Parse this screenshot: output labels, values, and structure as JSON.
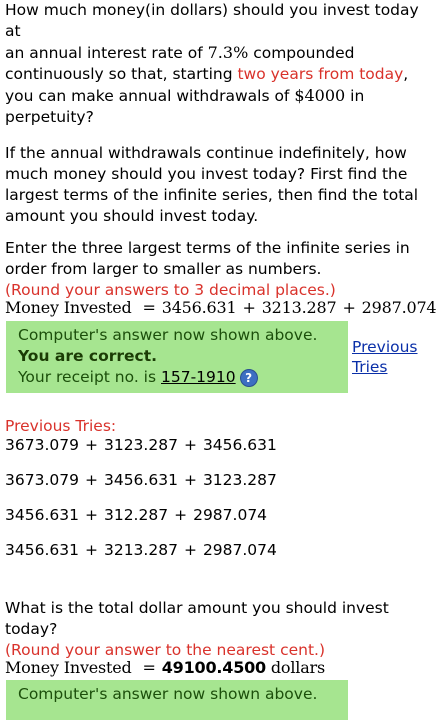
{
  "question": {
    "line1_a": "How much money(in dollars) should you invest today at",
    "line2_a": "an annual interest rate of ",
    "rate": "7.3%",
    "line2_b": " compounded",
    "line3_a": "continuously so that, starting ",
    "line3_red": "two years from today",
    "line3_b": ",",
    "line4_a": "you can make annual withdrawals of ",
    "amount": "$4000",
    "line4_b": " in",
    "line5": "perpetuity?"
  },
  "part1": {
    "p1": "If the annual withdrawals continue indefinitely, how",
    "p2": "much money should you invest today? First find the",
    "p3": "largest terms of the infinite series, then find the total",
    "p4": "amount you should invest today.",
    "e1": "Enter the three largest terms of the infinite series in",
    "e2": "order from larger to smaller as numbers.",
    "round_note": "(Round your answers to 3 decimal places.)",
    "answer_label": "Money Invested",
    "eq": "=",
    "t1": "3456.631",
    "t2": "3213.287",
    "t3": "2987.074",
    "plus": "+"
  },
  "feedback1": {
    "computer_answer": "Computer's answer now shown above.",
    "correct": "You are correct.",
    "receipt_label": "Your receipt no. is ",
    "receipt_no": "157-1910",
    "help": "?",
    "previous_tries_1": "Previous",
    "previous_tries_2": "Tries"
  },
  "previous_tries": {
    "heading": "Previous Tries:",
    "tries": [
      [
        "3673.079",
        "3123.287",
        "3456.631"
      ],
      [
        "3673.079",
        "3456.631",
        "3123.287"
      ],
      [
        "3456.631",
        "312.287",
        "2987.074"
      ],
      [
        "3456.631",
        "3213.287",
        "2987.074"
      ]
    ]
  },
  "part2": {
    "q1": "What is the total dollar amount you should invest",
    "q2": "today?",
    "round_note": "(Round your answer to the nearest cent.)",
    "answer_label": "Money Invested",
    "eq": "=",
    "value": "49100.4500",
    "unit": "dollars"
  },
  "feedback2": {
    "computer_answer": "Computer's answer now shown above."
  }
}
